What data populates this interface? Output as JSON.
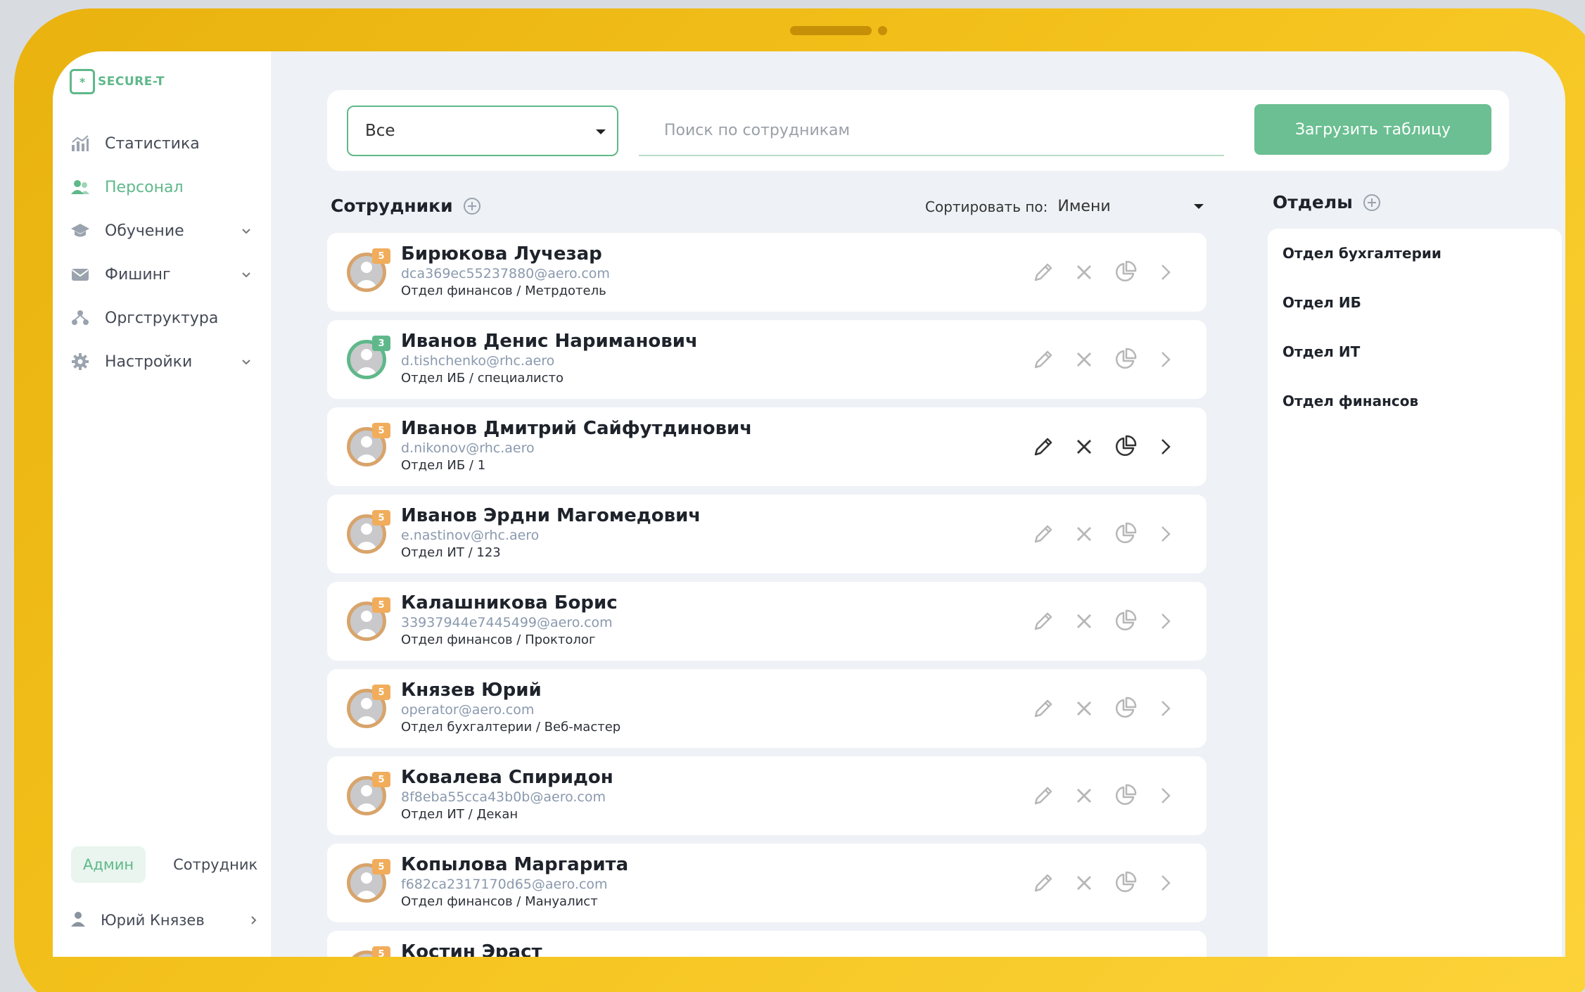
{
  "app": {
    "logo_text": "SECURE-T",
    "logo_mark": "*"
  },
  "sidebar": {
    "items": [
      {
        "label": "Статистика",
        "icon": "chart-bars-icon",
        "active": false,
        "expandable": false
      },
      {
        "label": "Персонал",
        "icon": "users-icon",
        "active": true,
        "expandable": false
      },
      {
        "label": "Обучение",
        "icon": "graduation-cap-icon",
        "active": false,
        "expandable": true
      },
      {
        "label": "Фишинг",
        "icon": "mail-icon",
        "active": false,
        "expandable": true
      },
      {
        "label": "Оргструктура",
        "icon": "org-structure-icon",
        "active": false,
        "expandable": false
      },
      {
        "label": "Настройки",
        "icon": "gear-icon",
        "active": false,
        "expandable": true
      }
    ],
    "roles": {
      "admin": "Админ",
      "employee": "Сотрудник",
      "active": "admin"
    },
    "user_name": "Юрий Князев"
  },
  "toolbar": {
    "filter_value": "Все",
    "search_placeholder": "Поиск по сотрудникам",
    "upload_label": "Загрузить таблицу"
  },
  "employees": {
    "title": "Сотрудники",
    "sort_label": "Сортировать по:",
    "sort_value": "Имени",
    "items": [
      {
        "name": "Бирюкова Лучезар",
        "email": "dca369ec55237880@aero.com",
        "dept": "Отдел финансов / Метрдотель",
        "badge": "5",
        "badge_color": "#f1ad5c"
      },
      {
        "name": "Иванов Денис Нариманович",
        "email": "d.tishchenko@rhc.aero",
        "dept": "Отдел ИБ / специалисто",
        "badge": "3",
        "badge_color": "#5fb88a"
      },
      {
        "name": "Иванов Дмитрий Сайфутдинович",
        "email": "d.nikonov@rhc.aero",
        "dept": "Отдел ИБ / 1",
        "badge": "5",
        "badge_color": "#f1ad5c"
      },
      {
        "name": "Иванов Эрдни Магомедович",
        "email": "e.nastinov@rhc.aero",
        "dept": "Отдел ИТ / 123",
        "badge": "5",
        "badge_color": "#f1ad5c"
      },
      {
        "name": "Калашникова Борис",
        "email": "33937944e7445499@aero.com",
        "dept": "Отдел финансов / Проктолог",
        "badge": "5",
        "badge_color": "#f1ad5c"
      },
      {
        "name": "Князев Юрий",
        "email": "operator@aero.com",
        "dept": "Отдел бухгалтерии / Веб-мастер",
        "badge": "5",
        "badge_color": "#f1ad5c"
      },
      {
        "name": "Ковалева Спиридон",
        "email": "8f8eba55cca43b0b@aero.com",
        "dept": "Отдел ИТ / Декан",
        "badge": "5",
        "badge_color": "#f1ad5c"
      },
      {
        "name": "Копылова Маргарита",
        "email": "f682ca2317170d65@aero.com",
        "dept": "Отдел финансов / Мануалист",
        "badge": "5",
        "badge_color": "#f1ad5c"
      },
      {
        "name": "Костин Эраст",
        "email": "",
        "dept": "",
        "badge": "5",
        "badge_color": "#f1ad5c"
      }
    ]
  },
  "departments": {
    "title": "Отделы",
    "items": [
      "Отдел бухгалтерии",
      "Отдел ИБ",
      "Отдел ИТ",
      "Отдел финансов"
    ]
  },
  "colors": {
    "accent": "#5fb88a",
    "button": "#6bbf92",
    "badge_orange": "#f1ad5c",
    "frame": "#f4c21c"
  }
}
